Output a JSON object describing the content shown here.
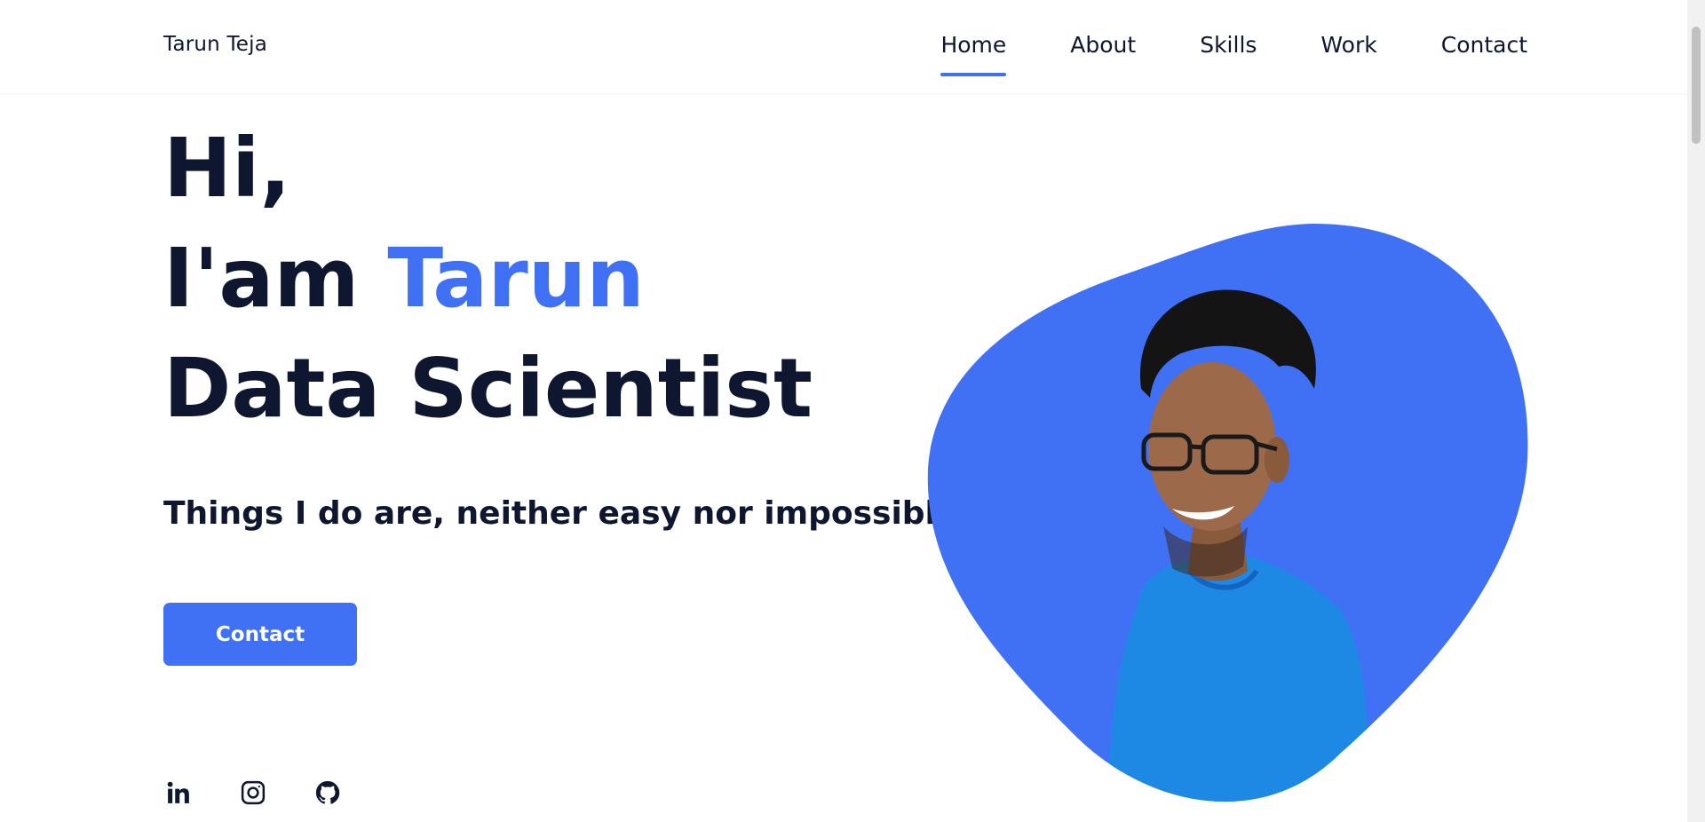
{
  "header": {
    "brand": "Tarun Teja",
    "nav": [
      {
        "label": "Home",
        "active": true
      },
      {
        "label": "About",
        "active": false
      },
      {
        "label": "Skills",
        "active": false
      },
      {
        "label": "Work",
        "active": false
      },
      {
        "label": "Contact",
        "active": false
      }
    ]
  },
  "hero": {
    "greeting": "Hi,",
    "intro_prefix": "I'am",
    "name": "Tarun",
    "role": "Data Scientist",
    "tagline": "Things I do are, neither easy nor impossible",
    "cta_label": "Contact"
  },
  "socials": [
    {
      "icon": "linkedin-icon"
    },
    {
      "icon": "instagram-icon"
    },
    {
      "icon": "github-icon"
    }
  ],
  "colors": {
    "accent": "#4070f4",
    "text": "#0e1630",
    "background": "#ffffff"
  }
}
